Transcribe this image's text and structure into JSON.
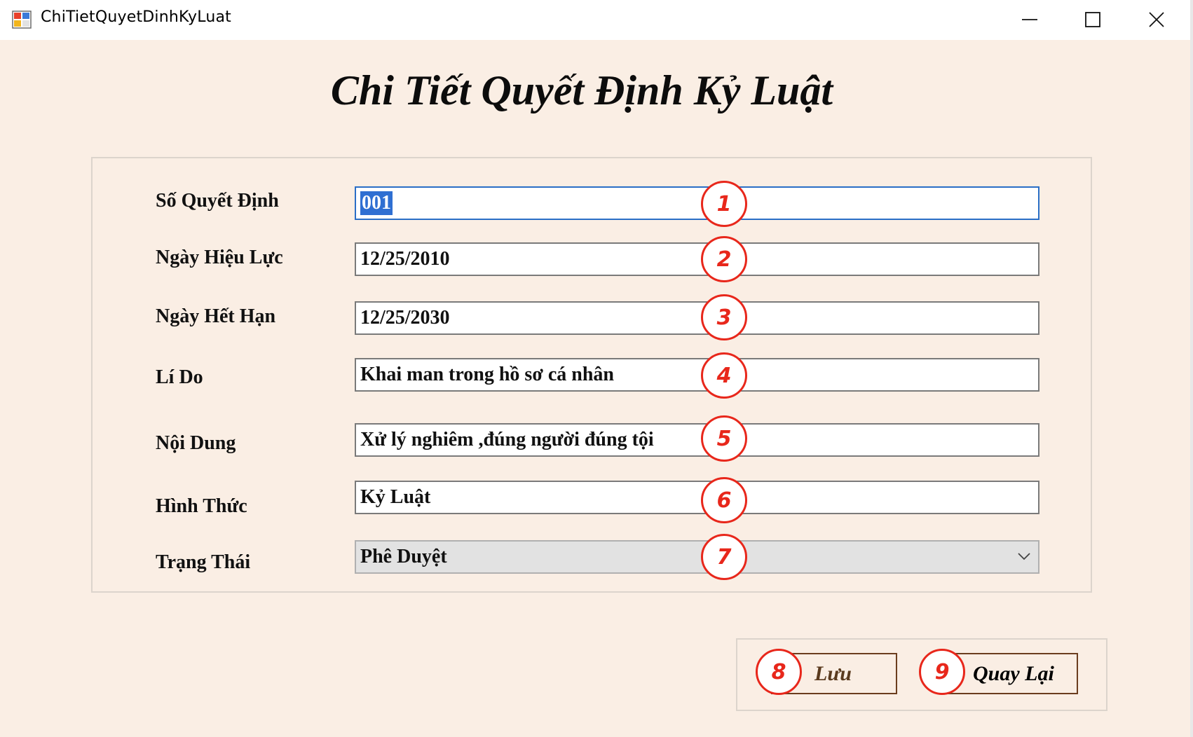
{
  "window": {
    "title": "ChiTietQuyetDinhKyLuat",
    "icon": "windows-form-icon",
    "controls": [
      "minimize-icon",
      "maximize-icon",
      "close-icon"
    ]
  },
  "heading": "Chi Tiết Quyết Định Kỷ Luật",
  "form": {
    "so_quyet_dinh": {
      "label": "Số Quyết Định",
      "value": "001",
      "marker": "1"
    },
    "ngay_hieu_luc": {
      "label": "Ngày Hiệu Lực",
      "value": "12/25/2010",
      "marker": "2"
    },
    "ngay_het_han": {
      "label": "Ngày Hết Hạn",
      "value": "12/25/2030",
      "marker": "3"
    },
    "li_do": {
      "label": "Lí Do",
      "value": "Khai man trong hồ sơ cá nhân",
      "marker": "4"
    },
    "noi_dung": {
      "label": "Nội Dung",
      "value": "Xử lý nghiêm ,đúng người đúng tội",
      "marker": "5"
    },
    "hinh_thuc": {
      "label": "Hình Thức",
      "value": "Kỷ Luật",
      "marker": "6"
    },
    "trang_thai": {
      "label": "Trạng Thái",
      "value": "Phê Duyệt",
      "marker": "7"
    }
  },
  "buttons": {
    "luu": {
      "label": "Lưu",
      "marker": "8",
      "color": "#5a3a1e"
    },
    "quay_lai": {
      "label": "Quay Lại",
      "marker": "9",
      "color": "#000000"
    }
  },
  "colors": {
    "background": "#faeee4",
    "marker": "#e8271b",
    "selection": "#2f6fd2",
    "focus_border": "#2a6ec6"
  }
}
